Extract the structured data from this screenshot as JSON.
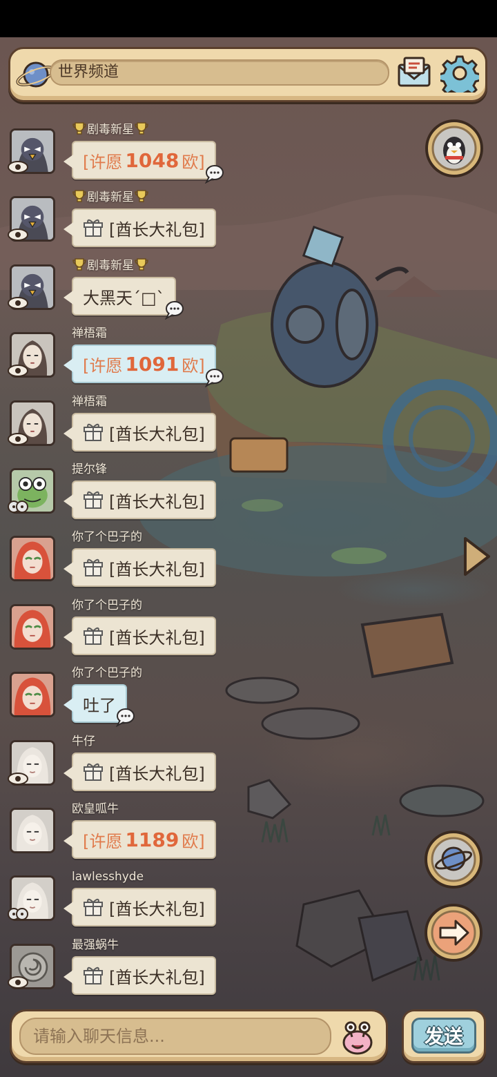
{
  "header": {
    "channel_title": "世界频道",
    "icons": [
      "planet-icon",
      "mail-icon",
      "gear-icon"
    ]
  },
  "side_buttons": [
    "penguin-icon",
    "planet-icon",
    "arrow-right-icon",
    "triangle-arrow-icon"
  ],
  "messages": [
    {
      "user": "剧毒新星",
      "trophy": true,
      "type": "wish",
      "prefix": "[许愿",
      "number": "1048",
      "suffix": "欧]",
      "bubble": "plain",
      "voice": true,
      "avatar": "bird",
      "badge": "eye"
    },
    {
      "user": "剧毒新星",
      "trophy": true,
      "type": "gift",
      "text": "[酋长大礼包]",
      "bubble": "plain",
      "voice": false,
      "avatar": "bird",
      "badge": "eye"
    },
    {
      "user": "剧毒新星",
      "trophy": true,
      "type": "text",
      "text": "大黑天ˊ□ˋ",
      "bubble": "plain",
      "voice": true,
      "avatar": "bird",
      "badge": "eye"
    },
    {
      "user": "禅梧霜",
      "trophy": false,
      "type": "wish",
      "prefix": "[许愿",
      "number": "1091",
      "suffix": "欧]",
      "bubble": "blue",
      "voice": true,
      "avatar": "woman",
      "badge": "eye"
    },
    {
      "user": "禅梧霜",
      "trophy": false,
      "type": "gift",
      "text": "[酋长大礼包]",
      "bubble": "plain",
      "voice": false,
      "avatar": "woman",
      "badge": "eye"
    },
    {
      "user": "提尔锋",
      "trophy": false,
      "type": "gift",
      "text": "[酋长大礼包]",
      "bubble": "plain",
      "voice": false,
      "avatar": "frog",
      "badge": "chat"
    },
    {
      "user": "你了个巴子的",
      "trophy": false,
      "type": "gift",
      "text": "[酋长大礼包]",
      "bubble": "plain",
      "voice": false,
      "avatar": "redhair",
      "badge": "none"
    },
    {
      "user": "你了个巴子的",
      "trophy": false,
      "type": "gift",
      "text": "[酋长大礼包]",
      "bubble": "plain",
      "voice": false,
      "avatar": "redhair",
      "badge": "none"
    },
    {
      "user": "你了个巴子的",
      "trophy": false,
      "type": "text",
      "text": "吐了",
      "bubble": "blue",
      "voice": true,
      "avatar": "redhair",
      "badge": "none"
    },
    {
      "user": "牛仔",
      "trophy": false,
      "type": "gift",
      "text": "[酋长大礼包]",
      "bubble": "plain",
      "voice": false,
      "avatar": "pale",
      "badge": "eye"
    },
    {
      "user": "欧皇呱牛",
      "trophy": false,
      "type": "wish",
      "prefix": "[许愿",
      "number": "1189",
      "suffix": "欧]",
      "bubble": "plain",
      "voice": false,
      "avatar": "pale",
      "badge": "none"
    },
    {
      "user": "lawlesshyde",
      "trophy": false,
      "type": "gift",
      "text": "[酋长大礼包]",
      "bubble": "plain",
      "voice": false,
      "avatar": "pale",
      "badge": "chat"
    },
    {
      "user": "最强蜗牛",
      "trophy": false,
      "type": "gift",
      "text": "[酋长大礼包]",
      "bubble": "plain",
      "voice": false,
      "avatar": "snail",
      "badge": "eye"
    }
  ],
  "composer": {
    "placeholder": "请输入聊天信息...",
    "send_label": "发送"
  },
  "colors": {
    "frame": "#efd9ac",
    "frame_border": "#5a3f2c",
    "bubble": "#ece4d2",
    "bubble_blue": "#d9eef3",
    "wish_text": "#e07a4b",
    "send_button": "#9fd0dd"
  }
}
